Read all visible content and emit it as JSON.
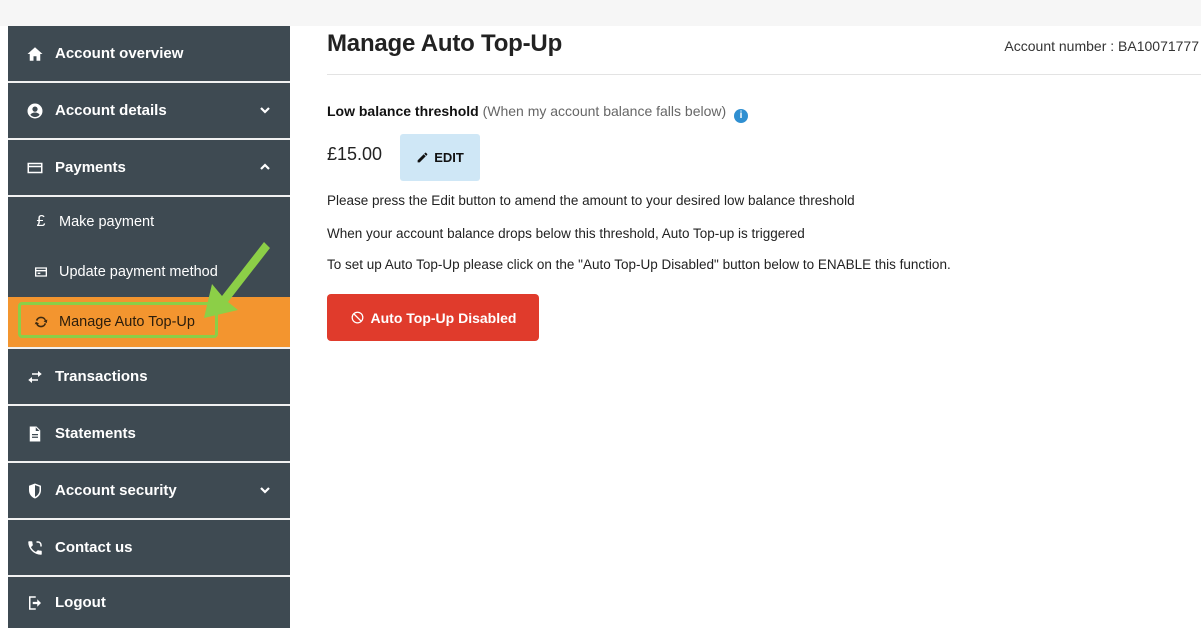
{
  "sidebar": {
    "items": [
      {
        "label": "Account overview",
        "icon": "home-icon"
      },
      {
        "label": "Account details",
        "icon": "user-circle-icon"
      },
      {
        "label": "Payments",
        "icon": "card-icon"
      },
      {
        "label": "Transactions",
        "icon": "arrows-exchange-icon"
      },
      {
        "label": "Statements",
        "icon": "document-icon"
      },
      {
        "label": "Account security",
        "icon": "shield-icon"
      },
      {
        "label": "Contact us",
        "icon": "phone-icon"
      },
      {
        "label": "Logout",
        "icon": "logout-icon"
      }
    ],
    "payments_sub": [
      {
        "label": "Make payment",
        "icon": "pound-icon"
      },
      {
        "label": "Update payment method",
        "icon": "card-outline-icon"
      },
      {
        "label": "Manage Auto Top-Up",
        "icon": "refresh-icon"
      }
    ]
  },
  "main": {
    "title": "Manage Auto Top-Up",
    "account_number": "Account number : BA10071777",
    "threshold_label": "Low balance threshold",
    "threshold_hint": "(When my account balance falls below)",
    "info_icon": "i",
    "amount": "£15.00",
    "edit_label": "EDIT",
    "para1": "Please press the Edit button to amend the amount to your desired low balance threshold",
    "para2": "When your account balance drops below this threshold, Auto Top-up is triggered",
    "para3": "To set up Auto Top-Up please click on the \"Auto Top-Up Disabled\" button below to ENABLE this function.",
    "disabled_label": "Auto Top-Up Disabled"
  },
  "colors": {
    "sidebar_bg": "#3e4a52",
    "active_bg": "#f3952f",
    "highlight": "#8ccf47",
    "edit_bg": "#cfe7f6",
    "danger": "#e03b2c",
    "info": "#2f8fd1"
  }
}
